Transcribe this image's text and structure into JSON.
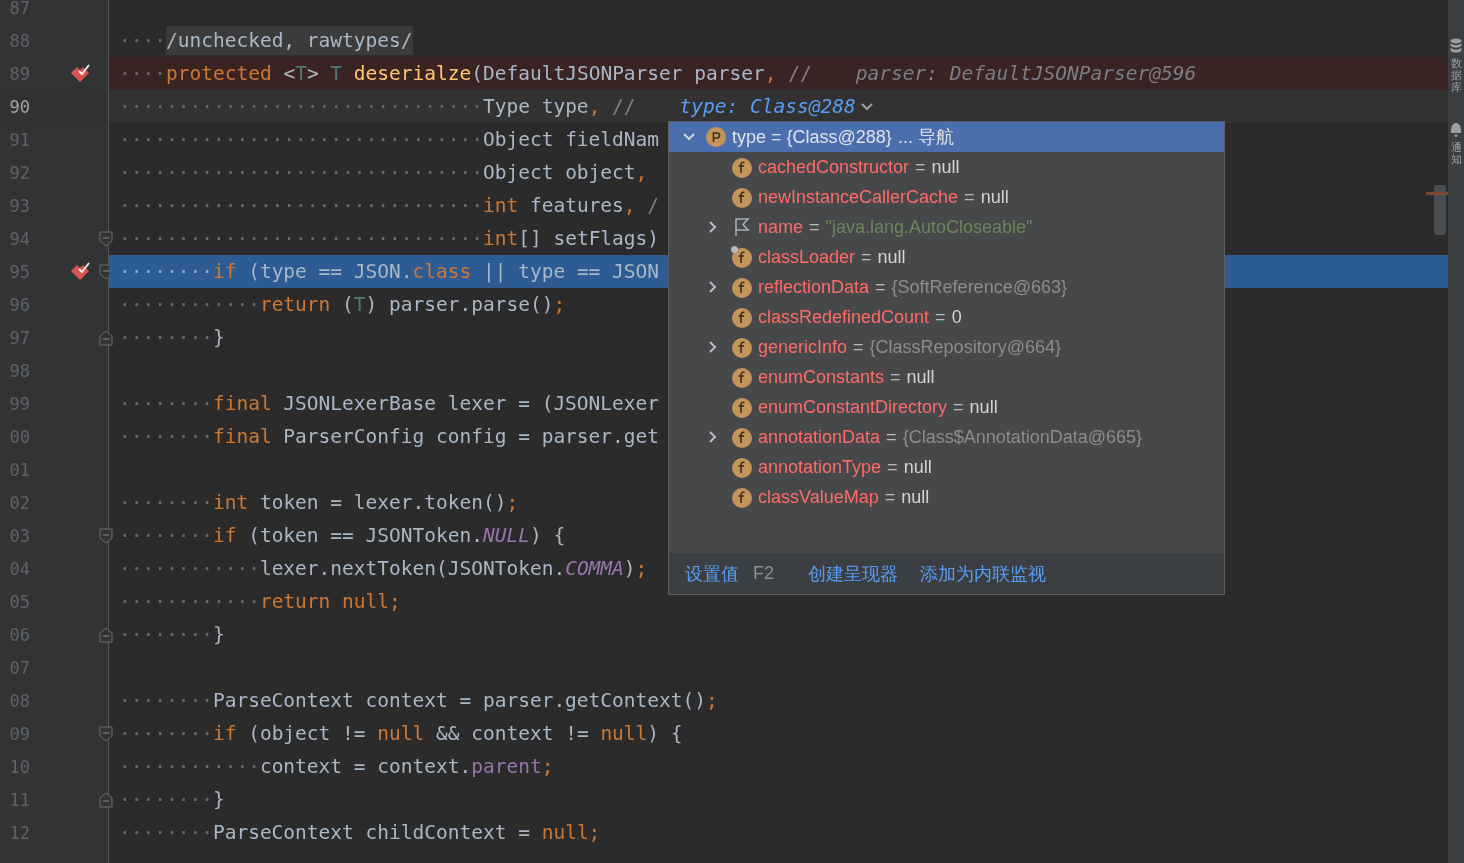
{
  "editor": {
    "lines": [
      {
        "number": "87",
        "kind": "plain",
        "breakpoint": false
      },
      {
        "number": "88",
        "kind": "plain",
        "breakpoint": false,
        "tokens": [
          {
            "kind": "ws",
            "text": "····"
          },
          {
            "kind": "folded",
            "text": "/unchecked, rawtypes/"
          }
        ]
      },
      {
        "number": "89",
        "kind": "breakpoint",
        "breakpoint": true,
        "tokens": [
          {
            "kind": "ws",
            "text": "····"
          },
          {
            "kind": "keyword",
            "text": "protected"
          },
          {
            "kind": "plain",
            "text": " <"
          },
          {
            "kind": "tparam",
            "text": "T"
          },
          {
            "kind": "plain",
            "text": "> "
          },
          {
            "kind": "tparam",
            "text": "T"
          },
          {
            "kind": "method",
            "text": " deserialze"
          },
          {
            "kind": "plain",
            "text": "(DefaultJSONParser parser"
          },
          {
            "kind": "keyword",
            "text": ","
          },
          {
            "kind": "comment",
            "text": " //"
          }
        ],
        "hint": {
          "kind": "value",
          "text": "parser: DefaultJSONParser@596"
        }
      },
      {
        "number": "90",
        "kind": "caret",
        "breakpoint": false,
        "tokens": [
          {
            "kind": "ws",
            "text": "·······························"
          },
          {
            "kind": "plain",
            "text": "Type type"
          },
          {
            "kind": "keyword",
            "text": ","
          },
          {
            "kind": "comment",
            "text": " //"
          }
        ],
        "hint": {
          "kind": "link",
          "text": "type: Class@288"
        }
      },
      {
        "number": "91",
        "kind": "plain",
        "breakpoint": false,
        "tokens": [
          {
            "kind": "ws",
            "text": "·······························"
          },
          {
            "kind": "plain",
            "text": "Object fieldNam"
          }
        ]
      },
      {
        "number": "92",
        "kind": "plain",
        "breakpoint": false,
        "tokens": [
          {
            "kind": "ws",
            "text": "·······························"
          },
          {
            "kind": "plain",
            "text": "Object object"
          },
          {
            "kind": "keyword",
            "text": ","
          }
        ]
      },
      {
        "number": "93",
        "kind": "plain",
        "breakpoint": false,
        "tokens": [
          {
            "kind": "ws",
            "text": "·······························"
          },
          {
            "kind": "keyword",
            "text": "int"
          },
          {
            "kind": "plain",
            "text": " features"
          },
          {
            "kind": "keyword",
            "text": ","
          },
          {
            "kind": "comment",
            "text": " /"
          }
        ]
      },
      {
        "number": "94",
        "kind": "plain",
        "breakpoint": false,
        "fold": {
          "kind": "start"
        },
        "tokens": [
          {
            "kind": "ws",
            "text": "·······························"
          },
          {
            "kind": "keyword",
            "text": "int"
          },
          {
            "kind": "plain",
            "text": "[] setFlags)"
          }
        ]
      },
      {
        "number": "95",
        "kind": "execution",
        "breakpoint": true,
        "fold": {
          "kind": "start"
        },
        "tokens": [
          {
            "kind": "ws",
            "text": "········"
          },
          {
            "kind": "keyword",
            "text": "if"
          },
          {
            "kind": "plain",
            "text": " (type == JSON."
          },
          {
            "kind": "keyword",
            "text": "class"
          },
          {
            "kind": "plain",
            "text": " || type == JSON"
          }
        ]
      },
      {
        "number": "96",
        "kind": "plain",
        "breakpoint": false,
        "tokens": [
          {
            "kind": "ws",
            "text": "············"
          },
          {
            "kind": "keyword",
            "text": "return"
          },
          {
            "kind": "plain",
            "text": " ("
          },
          {
            "kind": "tparam",
            "text": "T"
          },
          {
            "kind": "plain",
            "text": ") parser.parse()"
          },
          {
            "kind": "keyword",
            "text": ";"
          }
        ]
      },
      {
        "number": "97",
        "kind": "plain",
        "breakpoint": false,
        "fold": {
          "kind": "end"
        },
        "tokens": [
          {
            "kind": "ws",
            "text": "········"
          },
          {
            "kind": "plain",
            "text": "}"
          }
        ]
      },
      {
        "number": "98",
        "kind": "plain",
        "breakpoint": false
      },
      {
        "number": "99",
        "kind": "plain",
        "breakpoint": false,
        "tokens": [
          {
            "kind": "ws",
            "text": "········"
          },
          {
            "kind": "keyword",
            "text": "final"
          },
          {
            "kind": "plain",
            "text": " JSONLexerBase lexer = (JSONLexer"
          }
        ]
      },
      {
        "number": "00",
        "kind": "plain",
        "breakpoint": false,
        "tokens": [
          {
            "kind": "ws",
            "text": "········"
          },
          {
            "kind": "keyword",
            "text": "final"
          },
          {
            "kind": "plain",
            "text": " ParserConfig config = parser.get"
          }
        ]
      },
      {
        "number": "01",
        "kind": "plain",
        "breakpoint": false
      },
      {
        "number": "02",
        "kind": "plain",
        "breakpoint": false,
        "tokens": [
          {
            "kind": "ws",
            "text": "········"
          },
          {
            "kind": "keyword",
            "text": "int"
          },
          {
            "kind": "plain",
            "text": " token = lexer.token()"
          },
          {
            "kind": "keyword",
            "text": ";"
          }
        ]
      },
      {
        "number": "03",
        "kind": "plain",
        "breakpoint": false,
        "fold": {
          "kind": "start"
        },
        "tokens": [
          {
            "kind": "ws",
            "text": "········"
          },
          {
            "kind": "keyword",
            "text": "if"
          },
          {
            "kind": "plain",
            "text": " (token == JSONToken."
          },
          {
            "kind": "constant",
            "text": "NULL"
          },
          {
            "kind": "plain",
            "text": ") {"
          }
        ]
      },
      {
        "number": "04",
        "kind": "plain",
        "breakpoint": false,
        "tokens": [
          {
            "kind": "ws",
            "text": "············"
          },
          {
            "kind": "plain",
            "text": "lexer.nextToken(JSONToken."
          },
          {
            "kind": "constant",
            "text": "COMMA"
          },
          {
            "kind": "plain",
            "text": ")"
          },
          {
            "kind": "keyword",
            "text": ";"
          }
        ]
      },
      {
        "number": "05",
        "kind": "plain",
        "breakpoint": false,
        "tokens": [
          {
            "kind": "ws",
            "text": "············"
          },
          {
            "kind": "keyword",
            "text": "return null;"
          }
        ]
      },
      {
        "number": "06",
        "kind": "plain",
        "breakpoint": false,
        "fold": {
          "kind": "end"
        },
        "tokens": [
          {
            "kind": "ws",
            "text": "········"
          },
          {
            "kind": "plain",
            "text": "}"
          }
        ]
      },
      {
        "number": "07",
        "kind": "plain",
        "breakpoint": false
      },
      {
        "number": "08",
        "kind": "plain",
        "breakpoint": false,
        "tokens": [
          {
            "kind": "ws",
            "text": "········"
          },
          {
            "kind": "plain",
            "text": "ParseContext context = parser.getContext()"
          },
          {
            "kind": "keyword",
            "text": ";"
          }
        ]
      },
      {
        "number": "09",
        "kind": "plain",
        "breakpoint": false,
        "fold": {
          "kind": "start"
        },
        "tokens": [
          {
            "kind": "ws",
            "text": "········"
          },
          {
            "kind": "keyword",
            "text": "if"
          },
          {
            "kind": "plain",
            "text": " (object != "
          },
          {
            "kind": "keyword",
            "text": "null"
          },
          {
            "kind": "plain",
            "text": " && context != "
          },
          {
            "kind": "keyword",
            "text": "null"
          },
          {
            "kind": "plain",
            "text": ") {"
          }
        ]
      },
      {
        "number": "10",
        "kind": "plain",
        "breakpoint": false,
        "tokens": [
          {
            "kind": "ws",
            "text": "············"
          },
          {
            "kind": "plain",
            "text": "context = context."
          },
          {
            "kind": "field",
            "text": "parent"
          },
          {
            "kind": "keyword",
            "text": ";"
          }
        ]
      },
      {
        "number": "11",
        "kind": "plain",
        "breakpoint": false,
        "fold": {
          "kind": "end"
        },
        "tokens": [
          {
            "kind": "ws",
            "text": "········"
          },
          {
            "kind": "plain",
            "text": "}"
          }
        ]
      },
      {
        "number": "12",
        "kind": "plain",
        "breakpoint": false,
        "tokens": [
          {
            "kind": "ws",
            "text": "········"
          },
          {
            "kind": "plain",
            "text": "ParseContext childContext = "
          },
          {
            "kind": "keyword",
            "text": "null;"
          }
        ]
      }
    ]
  },
  "popup": {
    "header": {
      "text": "type = {Class@288}",
      "nav": "... 导航",
      "expanded": true
    },
    "rows": [
      {
        "kind": "field",
        "expandable": false,
        "badge": false,
        "name": "cachedConstructor",
        "op": "=",
        "value": {
          "kind": "null",
          "text": "null"
        }
      },
      {
        "kind": "field",
        "expandable": false,
        "badge": false,
        "name": "newInstanceCallerCache",
        "op": "=",
        "value": {
          "kind": "null",
          "text": "null"
        }
      },
      {
        "kind": "flag",
        "expandable": true,
        "badge": false,
        "name": "name",
        "op": "=",
        "value": {
          "kind": "string",
          "text": "\"java.lang.AutoCloseable\""
        }
      },
      {
        "kind": "field",
        "expandable": false,
        "badge": true,
        "name": "classLoader",
        "op": "=",
        "value": {
          "kind": "null",
          "text": "null"
        }
      },
      {
        "kind": "field",
        "expandable": true,
        "badge": false,
        "name": "reflectionData",
        "op": "=",
        "value": {
          "kind": "ref",
          "text": "{SoftReference@663}"
        }
      },
      {
        "kind": "field",
        "expandable": false,
        "badge": false,
        "name": "classRedefinedCount",
        "op": "=",
        "value": {
          "kind": "null",
          "text": "0"
        }
      },
      {
        "kind": "field",
        "expandable": true,
        "badge": false,
        "name": "genericInfo",
        "op": "=",
        "value": {
          "kind": "ref",
          "text": "{ClassRepository@664}"
        }
      },
      {
        "kind": "field",
        "expandable": false,
        "badge": false,
        "name": "enumConstants",
        "op": "=",
        "value": {
          "kind": "null",
          "text": "null"
        }
      },
      {
        "kind": "field",
        "expandable": false,
        "badge": false,
        "name": "enumConstantDirectory",
        "op": "=",
        "value": {
          "kind": "null",
          "text": "null"
        }
      },
      {
        "kind": "field",
        "expandable": true,
        "badge": false,
        "name": "annotationData",
        "op": "=",
        "value": {
          "kind": "ref",
          "text": "{Class$AnnotationData@665}"
        }
      },
      {
        "kind": "field",
        "expandable": false,
        "badge": false,
        "name": "annotationType",
        "op": "=",
        "value": {
          "kind": "null",
          "text": "null"
        }
      },
      {
        "kind": "field",
        "expandable": false,
        "badge": false,
        "name": "classValueMap",
        "op": "=",
        "value": {
          "kind": "null",
          "text": "null"
        }
      }
    ],
    "footer": {
      "set_value": "设置值",
      "shortcut": "F2",
      "create_renderer": "创建呈现器",
      "add_watch": "添加为内联监视"
    }
  },
  "side_strip": [
    {
      "kind": "database",
      "label": "数据库"
    },
    {
      "kind": "bell",
      "label": "通知"
    }
  ]
}
